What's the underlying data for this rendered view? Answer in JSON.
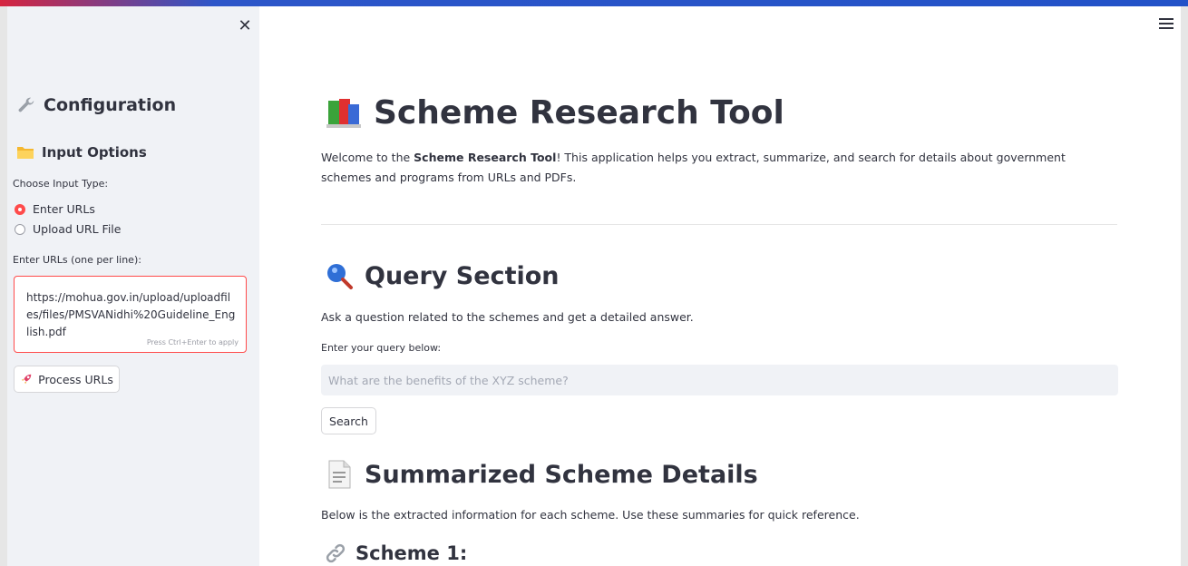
{
  "sidebar": {
    "config_title": "Configuration",
    "input_options_title": "Input Options",
    "choose_label": "Choose Input Type:",
    "radio_options": [
      "Enter URLs",
      "Upload URL File"
    ],
    "selected_option": "Enter URLs",
    "urls_label": "Enter URLs (one per line):",
    "urls_value": "https://mohua.gov.in/upload/uploadfiles/files/PMSVANidhi%20Guideline_English.pdf",
    "urls_hint": "Press Ctrl+Enter to apply",
    "process_button": "Process URLs",
    "close_symbol": "✕"
  },
  "main": {
    "title": "Scheme Research Tool",
    "welcome_prefix": "Welcome to the ",
    "welcome_bold": "Scheme Research Tool",
    "welcome_suffix": "! This application helps you extract, summarize, and search for details about government schemes and programs from URLs and PDFs.",
    "query_title": "Query Section",
    "query_desc": "Ask a question related to the schemes and get a detailed answer.",
    "query_label": "Enter your query below:",
    "query_placeholder": "What are the benefits of the XYZ scheme?",
    "search_button": "Search",
    "summary_title": "Summarized Scheme Details",
    "summary_desc": "Below is the extracted information for each scheme. Use these summaries for quick reference.",
    "scheme_title": "Scheme 1:"
  },
  "colors": {
    "accent": "#ff4b4b",
    "sidebar_bg": "#f0f2f6",
    "text": "#31333f"
  },
  "icons": {
    "config": "wrench-icon",
    "input_options": "folder-icon",
    "process": "rocket-icon",
    "title": "books-icon",
    "query": "magnifier-icon",
    "summary": "document-icon",
    "scheme": "link-icon",
    "menu": "hamburger-icon",
    "close": "close-icon"
  }
}
